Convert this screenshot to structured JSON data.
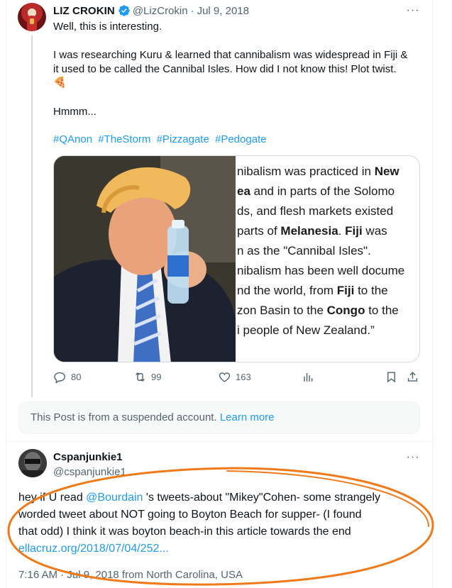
{
  "tweet": {
    "author_name": "LIZ CROKIN",
    "author_handle": "@LizCrokin",
    "separator": "·",
    "date": "Jul 9, 2018",
    "more_label": "···",
    "lines": [
      "Well, this is interesting.",
      "I was researching Kuru & learned that cannibalism was widespread in Fiji &",
      "it used to be called the Cannibal Isles. How did I not know this! Plot twist.",
      "🍕",
      "Hmmm..."
    ],
    "hashtags": [
      "#QAnon",
      "#TheStorm",
      "#Pizzagate",
      "#Pedogate"
    ],
    "media_quote": {
      "l1a": "nibalism was practiced in ",
      "l1b": "New",
      "l2a": "ea",
      "l2b": " and in parts of the Solomo",
      "l3": "ds, and flesh markets existed",
      "l4a": " parts of ",
      "l4b": "Melanesia",
      "l4c": ". ",
      "l4d": "Fiji",
      "l4e": " was",
      "l5": "n as the \"Cannibal Isles\".",
      "l6": "nibalism has been well docume",
      "l7a": "nd the world, from ",
      "l7b": "Fiji",
      "l7c": " to the",
      "l8a": "zon Basin to the ",
      "l8b": "Congo",
      "l8c": " to the",
      "l9": "i people of New Zealand.”"
    },
    "stats": {
      "replies": "80",
      "retweets": "99",
      "likes": "163"
    },
    "icons": [
      "reply-icon",
      "retweet-icon",
      "like-icon",
      "analytics-icon",
      "bookmark-icon",
      "share-icon"
    ]
  },
  "suspended_notice": {
    "text": "This Post is from a suspended account.",
    "link": "Learn more"
  },
  "reply": {
    "author_name": "Cspanjunkie1",
    "author_handle": "@cspanjunkie1",
    "more_label": "···",
    "line1_pre": "hey if U read ",
    "line1_mention": "@Bourdain",
    "line1_post": " 's tweets-about \"Mikey\"Cohen- some strangely",
    "line2": "worded tweet about NOT going to Boyton Beach for supper- (I found",
    "line3": "that odd) I think it was boyton beach-in this article towards the end",
    "link": "ellacruz.org/2018/07/04/252...",
    "meta": "7:16 AM · Jul 9, 2018 from North Carolina, USA"
  },
  "annotation": {
    "color": "#f07a1a"
  }
}
